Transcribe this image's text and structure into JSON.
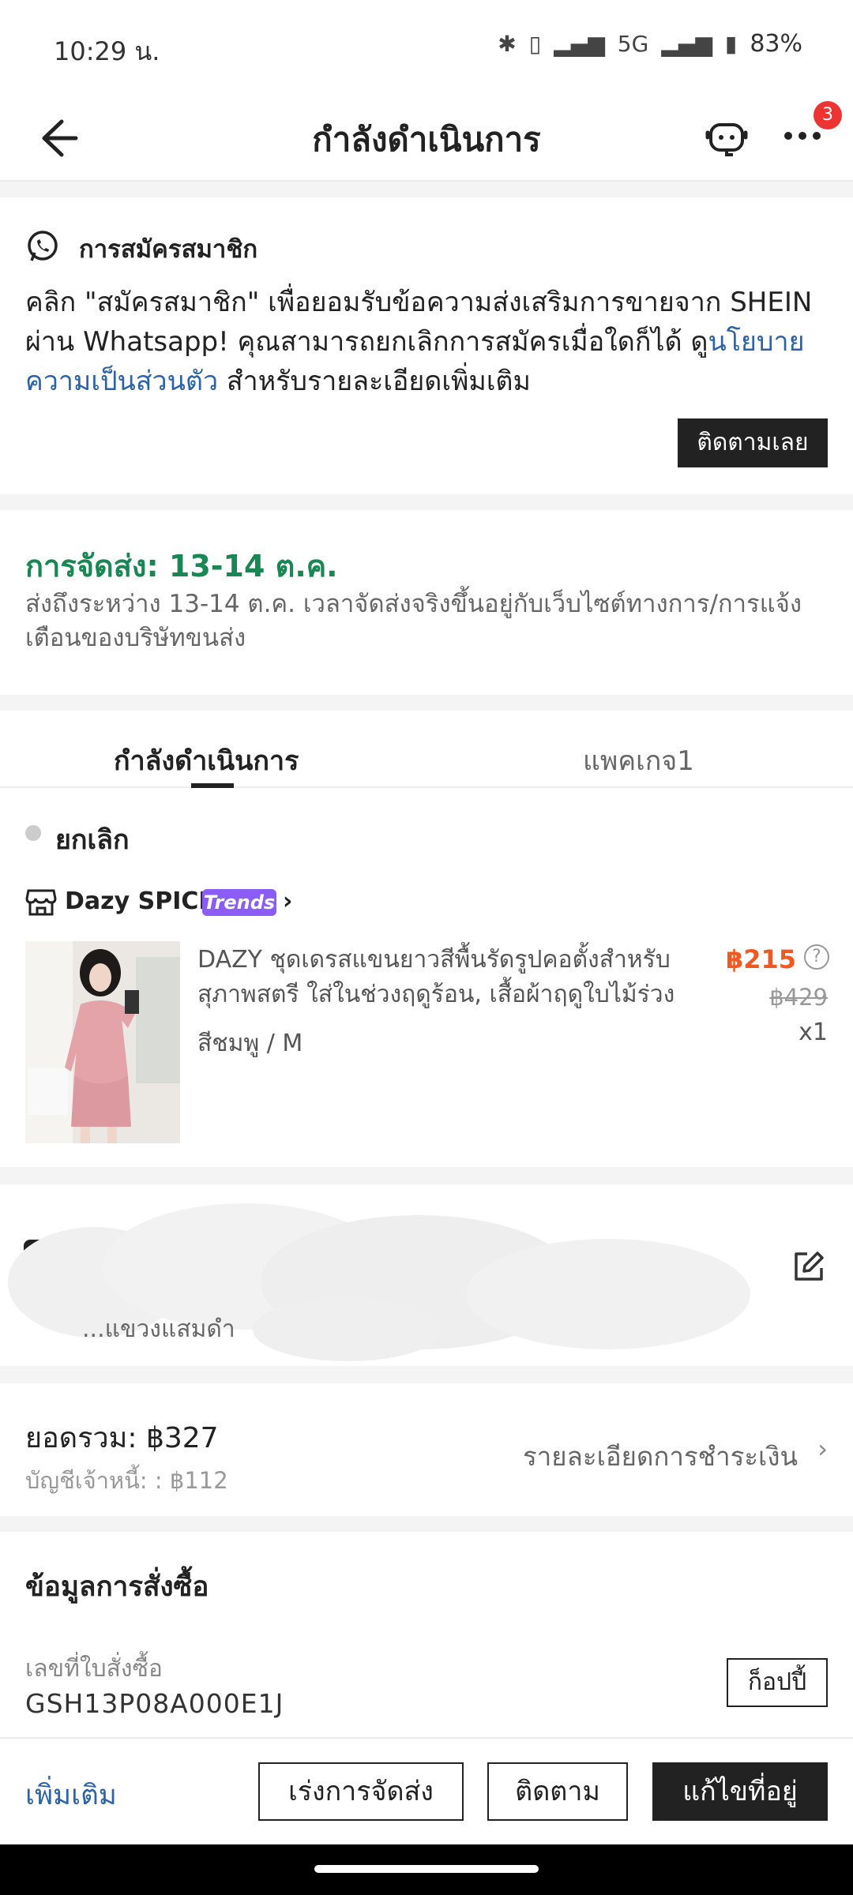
{
  "status_bar": {
    "time": "10:29 น.",
    "network": "5G",
    "battery": "83%"
  },
  "header": {
    "title": "กำลังดำเนินการ",
    "notification_count": "3"
  },
  "subscription": {
    "title": "การสมัครสมาชิก",
    "body_text": "คลิก \"สมัครสมาชิก\" เพื่อยอมรับข้อความส่งเสริมการขายจาก SHEIN ผ่าน Whatsapp! คุณสามารถยกเลิกการสมัครเมื่อใดก็ได้ ดู",
    "link_text": "นโยบายความเป็นส่วนตัว",
    "body_suffix": " สำหรับรายละเอียดเพิ่มเติม",
    "button_label": "ติดตามเลย"
  },
  "delivery": {
    "title": "การจัดส่ง: 13-14 ต.ค.",
    "description": "ส่งถึงระหว่าง 13-14 ต.ค. เวลาจัดส่งจริงขึ้นอยู่กับเว็บไซต์ทางการ/การแจ้งเตือนของบริษัทขนส่ง"
  },
  "tabs": [
    {
      "label": "กำลังดำเนินการ",
      "active": true
    },
    {
      "label": "แพคเกจ1",
      "active": false
    }
  ],
  "order_item": {
    "status": "ยกเลิก",
    "store_name": "Dazy SPICE",
    "store_badge": "Trends",
    "product_name": "DAZY ชุดเดรสแขนยาวสีพื้นรัดรูปคอตั้งสำหรับสุภาพสตรี ใส่ในช่วงฤดูร้อน, เสื้อผ้าฤดูใบไม้ร่วง",
    "variant": "สีชมพู / M",
    "price": "฿215",
    "original_price": "฿429",
    "quantity": "x1"
  },
  "address": {
    "line2": "...แขวงแสมดำ"
  },
  "totals": {
    "total_label": "ยอดรวม: ฿327",
    "debt_label": "บัญชีเจ้าหนี้: : ฿112",
    "payment_detail_link": "รายละเอียดการชำระเงิน"
  },
  "order_info": {
    "title": "ข้อมูลการสั่งซื้อ",
    "order_number_label": "เลขที่ใบสั่งซื้อ",
    "order_number": "GSH13P08A000E1J",
    "copy_button": "ก็อปปี้"
  },
  "bottom_actions": {
    "more_link": "เพิ่มเติม",
    "expedite_button": "เร่งการจัดส่ง",
    "track_button": "ติดตาม",
    "edit_address_button": "แก้ไขที่อยู่"
  },
  "colors": {
    "accent_green": "#198754",
    "price_orange": "#f05a22",
    "link_blue": "#2a63a8",
    "trends_purple": "#8b5cf6",
    "badge_red": "#e33333"
  }
}
